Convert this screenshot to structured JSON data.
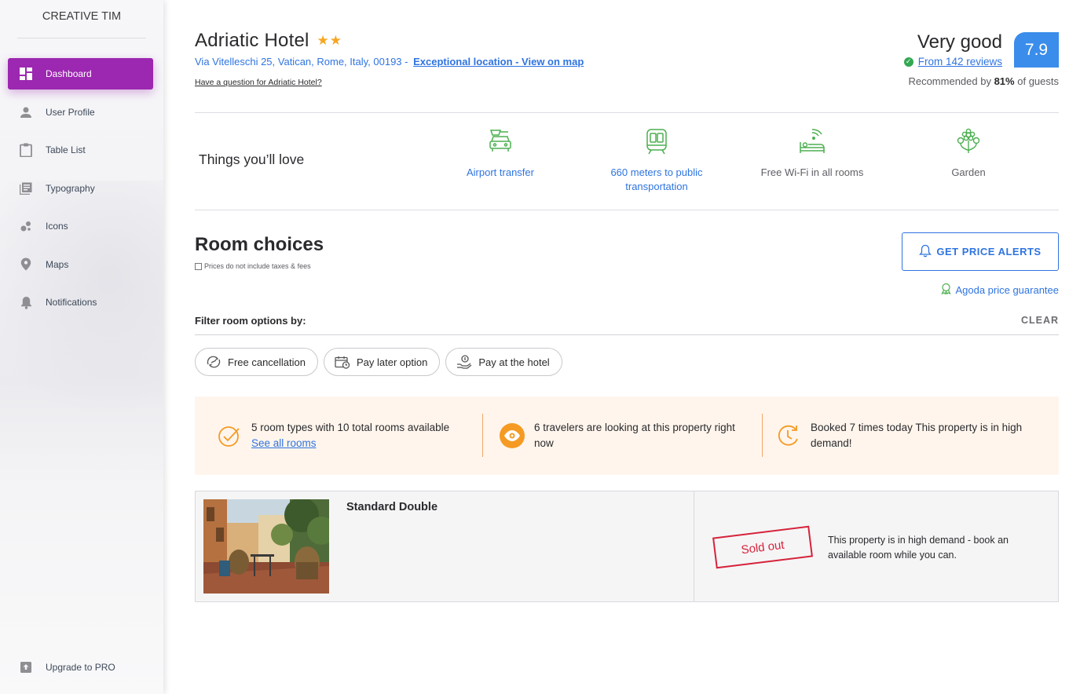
{
  "sidebar": {
    "brand": "CREATIVE TIM",
    "items": [
      {
        "label": "Dashboard",
        "icon": "dashboard-icon",
        "active": true
      },
      {
        "label": "User Profile",
        "icon": "person-icon"
      },
      {
        "label": "Table List",
        "icon": "clipboard-icon"
      },
      {
        "label": "Typography",
        "icon": "library-books-icon"
      },
      {
        "label": "Icons",
        "icon": "bubbles-icon"
      },
      {
        "label": "Maps",
        "icon": "location-pin-icon"
      },
      {
        "label": "Notifications",
        "icon": "bell-icon"
      }
    ],
    "upgrade": "Upgrade to PRO",
    "active_color": "#9c27b0"
  },
  "hotel": {
    "name": "Adriatic Hotel",
    "stars": 2,
    "stars_text": "★★",
    "address": "Via Vitelleschi 25, Vatican, Rome, Italy, 00193 -",
    "map_link": "Exceptional location - View on map",
    "question": "Have a question for Adriatic Hotel?"
  },
  "rating": {
    "label": "Very good",
    "score": "7.9",
    "reviews": "From 142 reviews",
    "recommend_prefix": "Recommended by",
    "recommend_pct": "81%",
    "recommend_suffix": "of guests",
    "score_color": "#3a8dea"
  },
  "love": {
    "title": "Things you’ll love",
    "amenities": [
      {
        "label": "Airport transfer",
        "icon": "airport-transfer-icon",
        "link": true
      },
      {
        "label": "660 meters to public transportation",
        "icon": "train-icon",
        "link": true
      },
      {
        "label": "Free Wi-Fi in all rooms",
        "icon": "wifi-bed-icon",
        "link": false
      },
      {
        "label": "Garden",
        "icon": "flower-icon",
        "link": false
      }
    ]
  },
  "rooms": {
    "title": "Room choices",
    "prices_note": "Prices do not include taxes & fees",
    "alerts_button": "GET PRICE ALERTS",
    "guarantee": "Agoda price guarantee"
  },
  "filter": {
    "label": "Filter room options by:",
    "clear": "CLEAR",
    "chips": [
      {
        "label": "Free cancellation",
        "icon": "cancellation-icon"
      },
      {
        "label": "Pay later option",
        "icon": "calendar-clock-icon"
      },
      {
        "label": "Pay at the hotel",
        "icon": "hand-coin-icon"
      }
    ]
  },
  "demand": {
    "availability": "5 room types with 10 total rooms available",
    "see_all": "See all rooms",
    "viewers": "6 travelers are looking at this property right now",
    "booked": "Booked 7 times today This property is in high demand!",
    "accent": "#f59a23"
  },
  "room": {
    "name": "Standard Double",
    "status": "Sold out",
    "note": "This property is in high demand - book an available room while you can."
  }
}
